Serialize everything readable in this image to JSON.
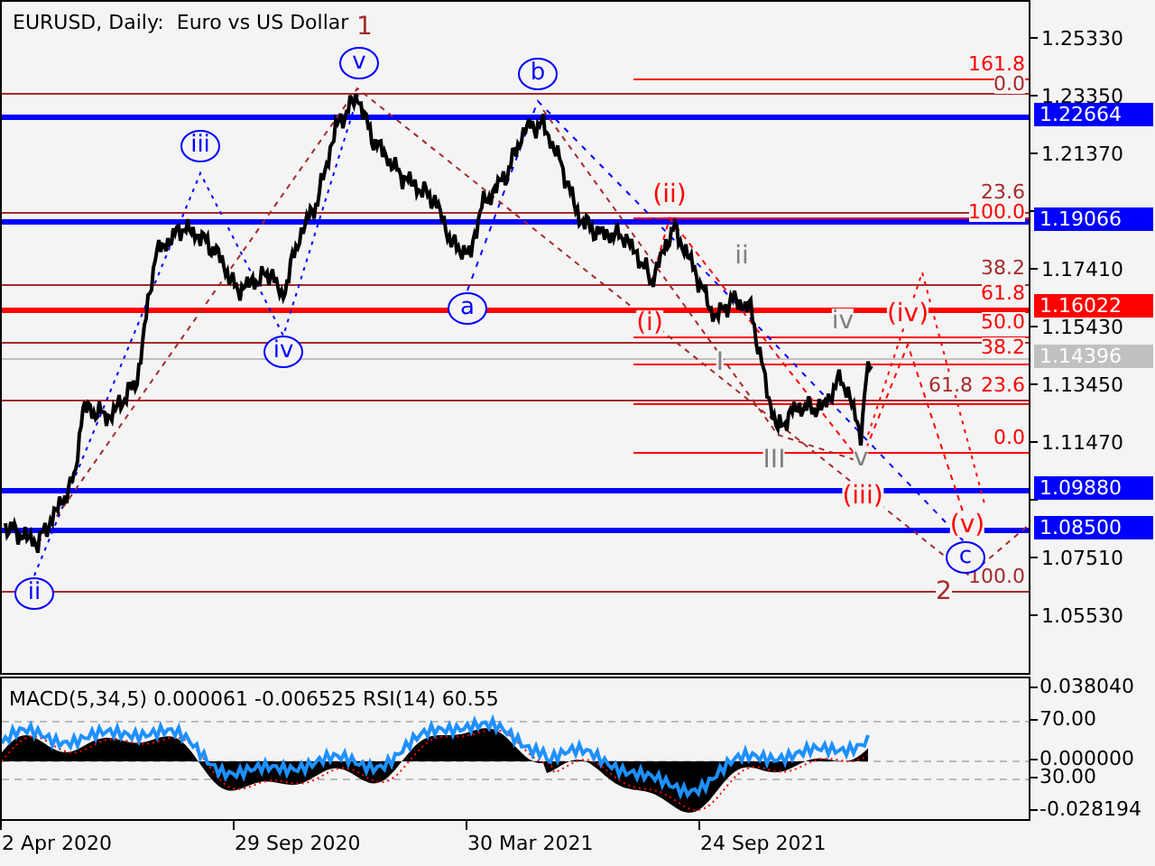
{
  "chart": {
    "title": "EURUSD, Daily:  Euro vs US Dollar",
    "price_scale": [
      "1.25330",
      "1.23350",
      "1.21370",
      "1.17410",
      "1.15430",
      "1.13450",
      "1.11470",
      "1.07510",
      "1.05530"
    ],
    "price_tags": [
      {
        "text": "1.22664",
        "color": "#0000ff"
      },
      {
        "text": "1.19066",
        "color": "#0000ff"
      },
      {
        "text": "1.16022",
        "color": "#ff0000"
      },
      {
        "text": "1.14396",
        "color": "#c0c0c0"
      },
      {
        "text": "1.09880",
        "color": "#0000ff"
      },
      {
        "text": "1.08500",
        "color": "#0000ff"
      }
    ],
    "fib_labels": [
      {
        "text": "161.8",
        "color": "#ff0000"
      },
      {
        "text": "0.0",
        "color": "#a52a2a"
      },
      {
        "text": "23.6",
        "color": "#a52a2a"
      },
      {
        "text": "100.0",
        "color": "#ff0000"
      },
      {
        "text": "38.2",
        "color": "#a52a2a"
      },
      {
        "text": "61.8",
        "color": "#ff0000"
      },
      {
        "text": "50.0",
        "color": "#ff0000"
      },
      {
        "text": "38.2",
        "color": "#ff0000"
      },
      {
        "text": "61.8",
        "color": "#a52a2a"
      },
      {
        "text": "23.6",
        "color": "#ff0000"
      },
      {
        "text": "0.0",
        "color": "#ff0000"
      },
      {
        "text": "100.0",
        "color": "#a52a2a"
      }
    ],
    "wave_labels": [
      {
        "text": "1",
        "kind": "plain",
        "color": "#a52a2a"
      },
      {
        "text": "v",
        "kind": "circled",
        "color": "#0000ff"
      },
      {
        "text": "b",
        "kind": "circled",
        "color": "#0000ff"
      },
      {
        "text": "iii",
        "kind": "circled",
        "color": "#0000ff"
      },
      {
        "text": "iv",
        "kind": "circled",
        "color": "#0000ff"
      },
      {
        "text": "a",
        "kind": "circled",
        "color": "#0000ff"
      },
      {
        "text": "ii",
        "kind": "circled",
        "color": "#0000ff"
      },
      {
        "text": "(ii)",
        "kind": "plain",
        "color": "#ff0000"
      },
      {
        "text": "(i)",
        "kind": "plain",
        "color": "#ff0000"
      },
      {
        "text": "ii",
        "kind": "plain",
        "color": "#808080"
      },
      {
        "text": "iv",
        "kind": "plain",
        "color": "#808080"
      },
      {
        "text": "(iv)",
        "kind": "plain",
        "color": "#ff0000"
      },
      {
        "text": "I",
        "kind": "plain",
        "color": "#808080"
      },
      {
        "text": "III",
        "kind": "plain",
        "color": "#808080"
      },
      {
        "text": "v",
        "kind": "plain",
        "color": "#808080"
      },
      {
        "text": "(iii)",
        "kind": "plain",
        "color": "#ff0000"
      },
      {
        "text": "(v)",
        "kind": "plain",
        "color": "#ff0000"
      },
      {
        "text": "c",
        "kind": "circled",
        "color": "#0000ff"
      },
      {
        "text": "2",
        "kind": "plain",
        "color": "#a52a2a"
      }
    ]
  },
  "indicator": {
    "title": "MACD(5,34,5) 0.000061 -0.006525 RSI(14) 60.55",
    "scale": [
      "0.038040",
      "70.00",
      "0.000000",
      "30.00",
      "-0.028194"
    ]
  },
  "time_axis": [
    "2 Apr 2020",
    "29 Sep 2020",
    "30 Mar 2021",
    "24 Sep 2021"
  ]
}
